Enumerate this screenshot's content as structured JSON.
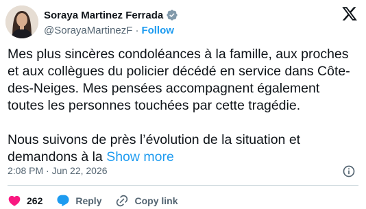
{
  "author": {
    "display_name": "Soraya Martinez Ferrada",
    "handle": "@SorayaMartinezF",
    "separator": "·",
    "follow_label": "Follow"
  },
  "tweet": {
    "line1": "Mes plus sincères condoléances à la famille, aux proches",
    "line2": "et aux collègues du policier décédé en service dans Côte-",
    "line3": "des-Neiges. Mes pensées accompagnent également",
    "line4": "toutes les personnes touchées par cette tragédie.",
    "line5": "Nous suivons de près l’évolution de la situation et",
    "line6_prefix": "demandons à la ",
    "show_more_label": "Show more",
    "timestamp": "2:08 PM · Jun 22, 2026"
  },
  "actions": {
    "likes_count": "262",
    "reply_label": "Reply",
    "copy_link_label": "Copy link"
  },
  "colors": {
    "accent": "#1d9bf0",
    "like": "#f91880",
    "text": "#0f1419",
    "secondary": "#536471"
  }
}
